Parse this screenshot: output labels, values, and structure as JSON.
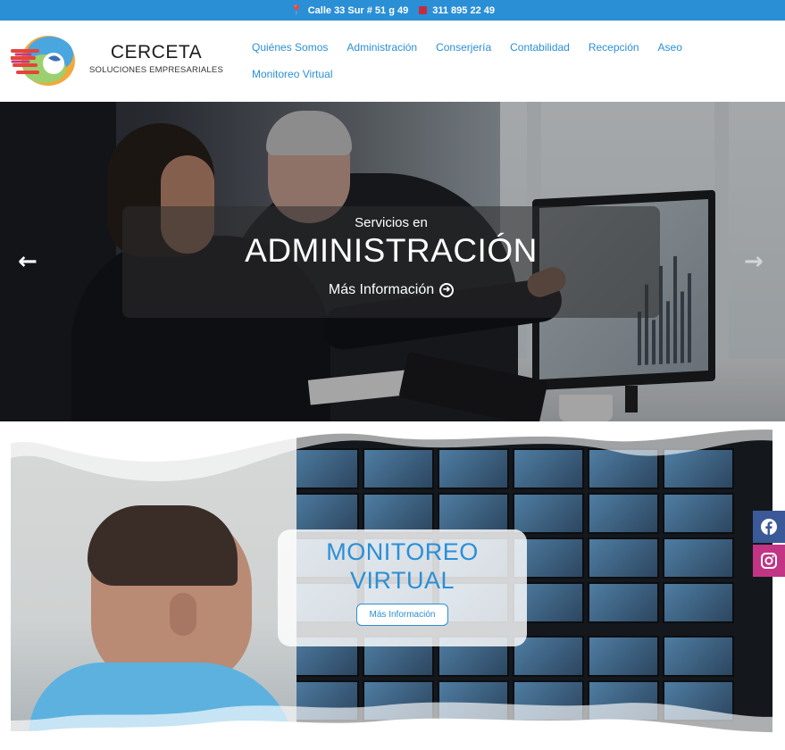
{
  "topbar": {
    "address": "Calle 33 Sur # 51 g 49",
    "phone": "311 895 22 49"
  },
  "brand": {
    "name": "CERCETA",
    "tagline": "SOLUCIONES EMPRESARIALES"
  },
  "nav": {
    "items": [
      {
        "label": "Quiénes Somos"
      },
      {
        "label": "Administración"
      },
      {
        "label": "Conserjería"
      },
      {
        "label": "Contabilidad"
      },
      {
        "label": "Recepción"
      },
      {
        "label": "Aseo"
      },
      {
        "label": "Monitoreo Virtual"
      }
    ]
  },
  "hero": {
    "subtitle": "Servicios en",
    "title": "ADMINISTRACIÓN",
    "more": "Más Información",
    "prev": "←",
    "next": "→"
  },
  "monitoreo": {
    "title_line1": "MONITOREO",
    "title_line2": "VIRTUAL",
    "button": "Más Información"
  },
  "social": {
    "facebook_icon": "facebook-icon",
    "instagram_icon": "instagram-icon"
  },
  "colors": {
    "accent": "#2b8fd6",
    "facebook": "#3b5998",
    "instagram": "#c13584"
  }
}
